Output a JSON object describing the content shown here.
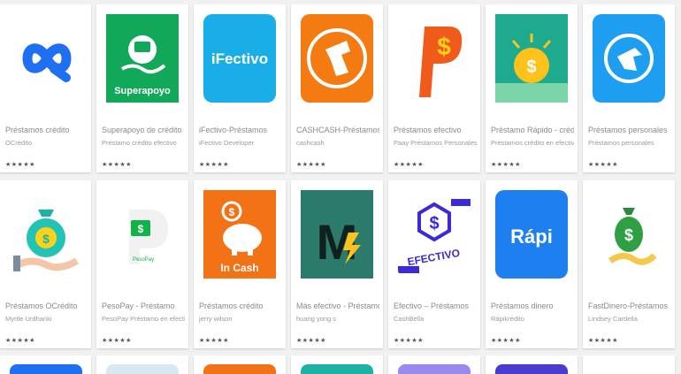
{
  "apps": [
    {
      "id": "oc",
      "title": "Préstamos crédito",
      "developer": "OCrédito",
      "rating_stars": "★★★★★"
    },
    {
      "id": "superapoyo",
      "title": "Superapoyo de crédito",
      "developer": "Préstamo crédito efectivo",
      "rating_stars": "★★★★★",
      "logo_text": "Superapoyo"
    },
    {
      "id": "ifectivo",
      "title": "iFectivo-Préstamos",
      "developer": "iFectivo Developer",
      "rating_stars": "★★★★★",
      "logo_text": "iFectivo"
    },
    {
      "id": "cashcash",
      "title": "CASHCASH-Préstamos",
      "developer": "cashcash",
      "rating_stars": "★★★★★"
    },
    {
      "id": "paay",
      "title": "Préstamos efectivo",
      "developer": "Paay Préstamos Personales",
      "rating_stars": "★★★★★"
    },
    {
      "id": "rapido",
      "title": "Préstamo Rápido - crédito",
      "developer": "Préstamos crédito en efectivo",
      "rating_stars": "★★★★★"
    },
    {
      "id": "personales",
      "title": "Préstamos personales",
      "developer": "Préstamos personales",
      "rating_stars": "★★★★★"
    },
    {
      "id": "ocredit",
      "title": "Préstamos OCrédito",
      "developer": "Myrtle Urdhanki",
      "rating_stars": "★★★★★"
    },
    {
      "id": "pesopay",
      "title": "PesoPay - Préstamo",
      "developer": "PesoPay Préstamo en efectivo",
      "rating_stars": "★★★★★",
      "logo_text": "PesoPay"
    },
    {
      "id": "incash",
      "title": "Préstamos crédito",
      "developer": "jerry wilson",
      "rating_stars": "★★★★★",
      "logo_text": "In Cash"
    },
    {
      "id": "mas",
      "title": "Más efectivo - Préstamos",
      "developer": "huang yong s",
      "rating_stars": "★★★★★",
      "logo_text": "M"
    },
    {
      "id": "efectivo",
      "title": "Efectivo – Préstamos",
      "developer": "CashBella",
      "rating_stars": "★★★★★",
      "logo_text": "EFECTIVO"
    },
    {
      "id": "rapi",
      "title": "Préstamos dinero",
      "developer": "Rápikrédito",
      "rating_stars": "★★★★★",
      "logo_text": "Rápi"
    },
    {
      "id": "fastdinero",
      "title": "FastDinero-Préstamos",
      "developer": "Lindsey Cardella",
      "rating_stars": "★★★★★"
    }
  ]
}
